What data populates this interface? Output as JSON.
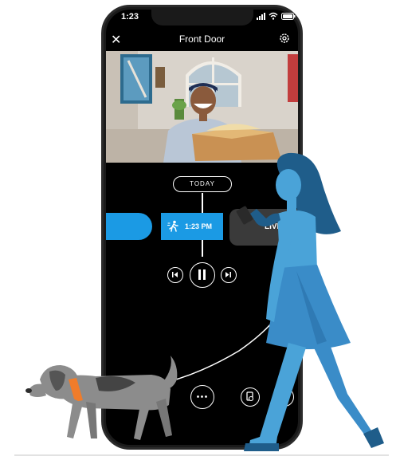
{
  "status": {
    "time": "1:23"
  },
  "header": {
    "title": "Front Door"
  },
  "timeline": {
    "date_pill": "TODAY",
    "events": [
      {
        "type": "motion",
        "time": "1:23 PM"
      },
      {
        "type": "live",
        "label": "LIVE"
      }
    ]
  },
  "icons": {
    "close": "close-icon",
    "settings": "gear-icon",
    "motion": "motion-icon",
    "skip_back": "skip-back-icon",
    "pause": "pause-icon",
    "skip_forward": "skip-forward-icon",
    "more": "more-icon",
    "history": "history-icon",
    "filter": "filter-icon"
  },
  "colors": {
    "accent": "#1b9ae4",
    "phone": "#1a1a1a",
    "woman_dark": "#1f5d8a",
    "woman_light": "#4aa3d8",
    "dog_gray": "#8c8c8c",
    "collar": "#f07c2a"
  }
}
